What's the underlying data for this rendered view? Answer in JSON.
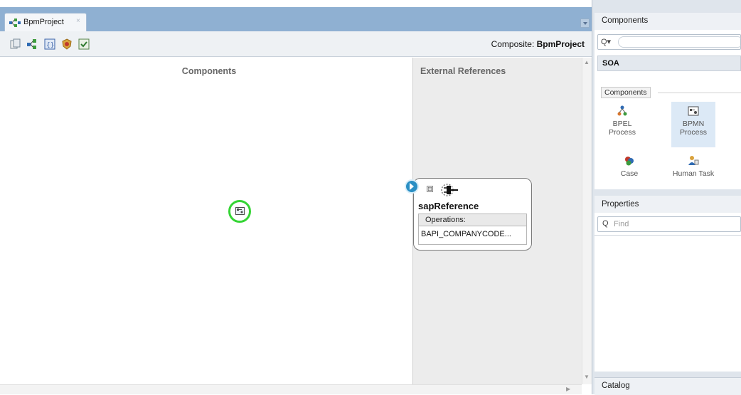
{
  "editor": {
    "tab_label": "BpmProject",
    "tab_close": "×",
    "composite_prefix": "Composite:",
    "composite_name": "BpmProject"
  },
  "canvas": {
    "components_title": "Components",
    "external_references_title": "External References",
    "reference": {
      "name": "sapReference",
      "operations_label": "Operations:",
      "operation": "BAPI_COMPANYCODE...",
      "collapse_glyph": "⊟"
    }
  },
  "components_panel": {
    "title": "Components",
    "search_glyph": "Q▾",
    "category": "SOA",
    "group_label": "Components",
    "items": [
      {
        "label": "BPEL Process",
        "icon": "bpel-process-icon"
      },
      {
        "label": "BPMN Process",
        "icon": "bpmn-process-icon"
      },
      {
        "label": "Case",
        "icon": "case-icon"
      },
      {
        "label": "Human Task",
        "icon": "human-task-icon"
      }
    ]
  },
  "properties_panel": {
    "title": "Properties",
    "find_glyph": "Q",
    "find_placeholder": "Find"
  },
  "catalog_panel": {
    "title": "Catalog"
  },
  "scroll": {
    "up": "▲",
    "down": "▼",
    "right": "▶"
  },
  "colors": {
    "tabbar": "#8fb0d2",
    "selection_ring": "#35d535",
    "connector": "#2a8fc4",
    "external_lane": "#ececec"
  }
}
